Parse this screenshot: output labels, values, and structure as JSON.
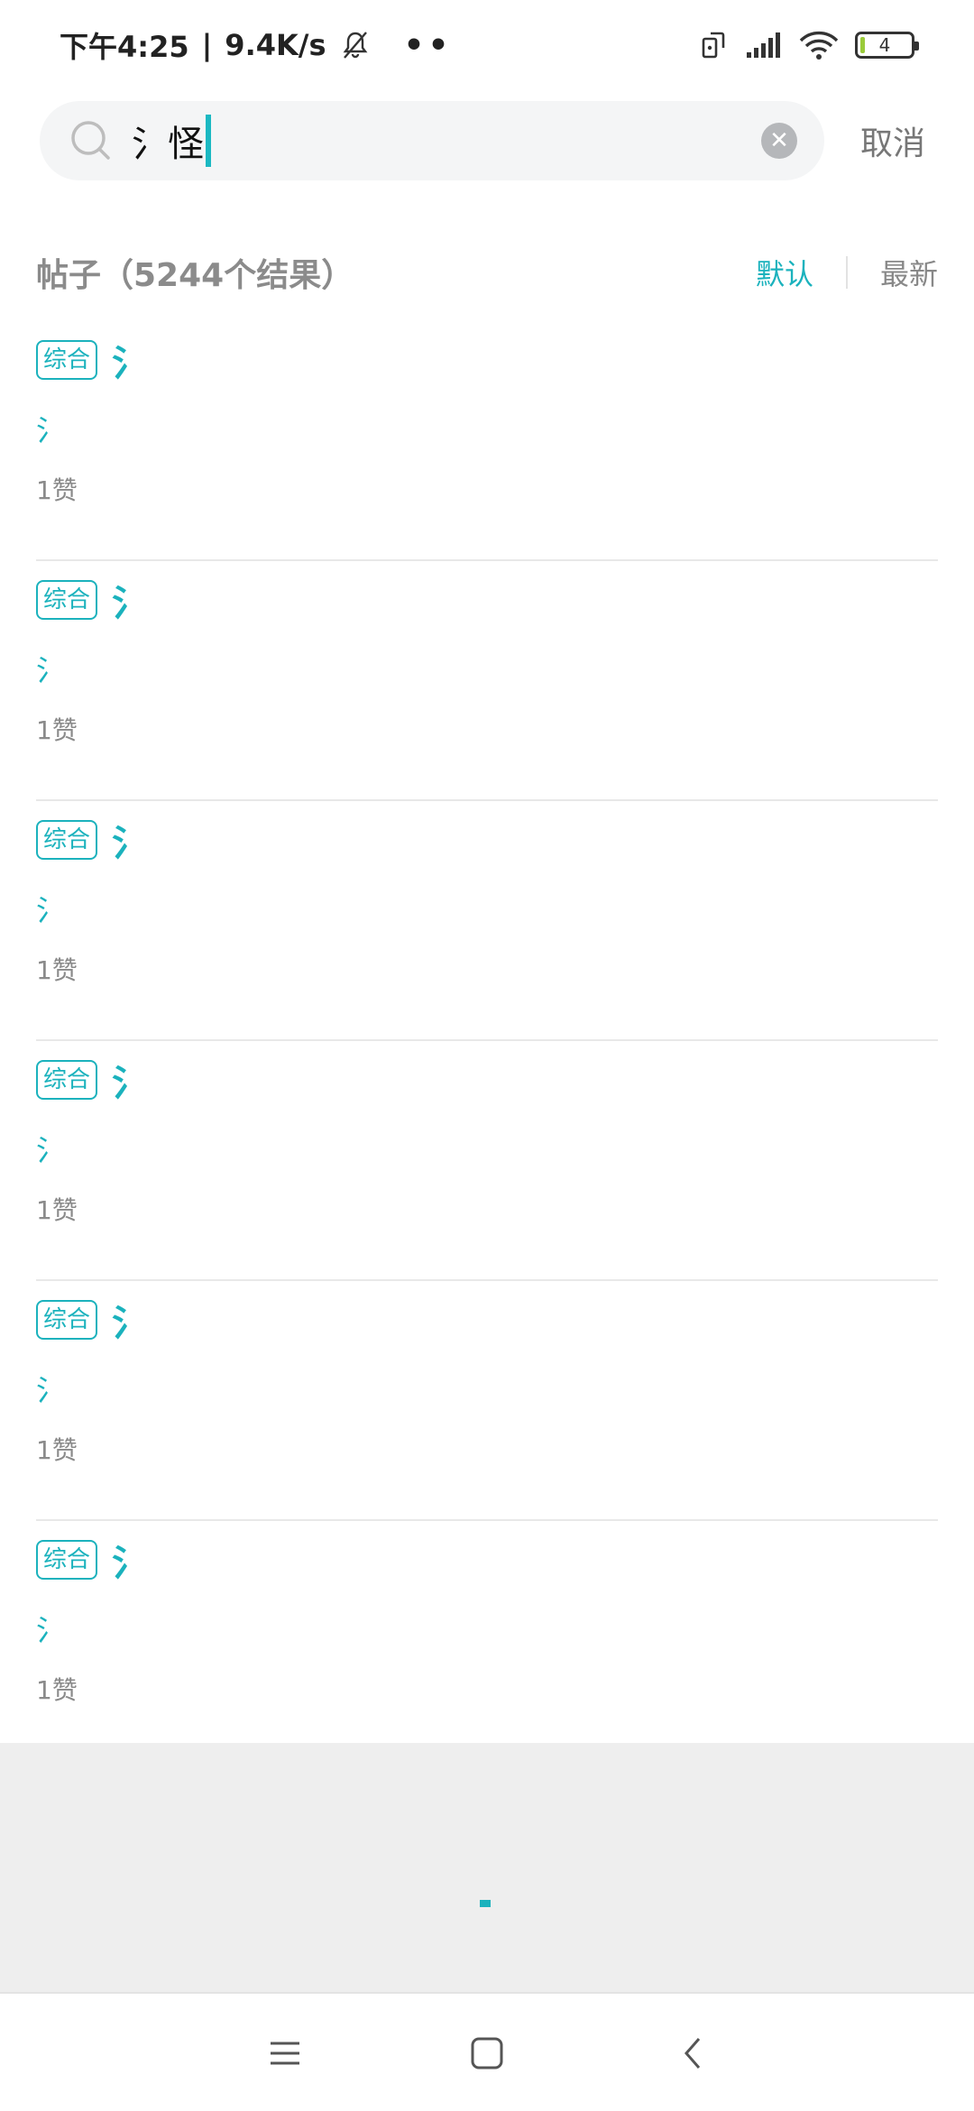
{
  "status_bar": {
    "time": "下午4:25",
    "separator": "|",
    "net_speed": "9.4K/s",
    "dots": "••",
    "battery_level": "4",
    "icons": [
      "bell-off-icon",
      "rotate-icon",
      "signal-icon",
      "wifi-icon",
      "battery-icon"
    ]
  },
  "search": {
    "query": "氵怪",
    "placeholder": "",
    "cancel_label": "取消"
  },
  "results_header": {
    "title": "帖子（5244个结果）",
    "sort_tabs": [
      "默认",
      "最新"
    ],
    "active_sort": "默认"
  },
  "results": [
    {
      "tag": "综合",
      "title": "氵",
      "snippet": "氵",
      "likes": "1赞"
    },
    {
      "tag": "综合",
      "title": "氵",
      "snippet": "氵",
      "likes": "1赞"
    },
    {
      "tag": "综合",
      "title": "氵",
      "snippet": "氵",
      "likes": "1赞"
    },
    {
      "tag": "综合",
      "title": "氵",
      "snippet": "氵",
      "likes": "1赞"
    },
    {
      "tag": "综合",
      "title": "氵",
      "snippet": "氵",
      "likes": "1赞"
    },
    {
      "tag": "综合",
      "title": "氵",
      "snippet": "氵",
      "likes": "1赞"
    }
  ],
  "colors": {
    "accent": "#1bb2bd",
    "muted_text": "#8a8a8a",
    "search_bg": "#f4f5f6",
    "loading_bg": "#eeeeee"
  },
  "nav_bar": {
    "buttons": [
      "menu-icon",
      "home-icon",
      "back-icon"
    ]
  }
}
